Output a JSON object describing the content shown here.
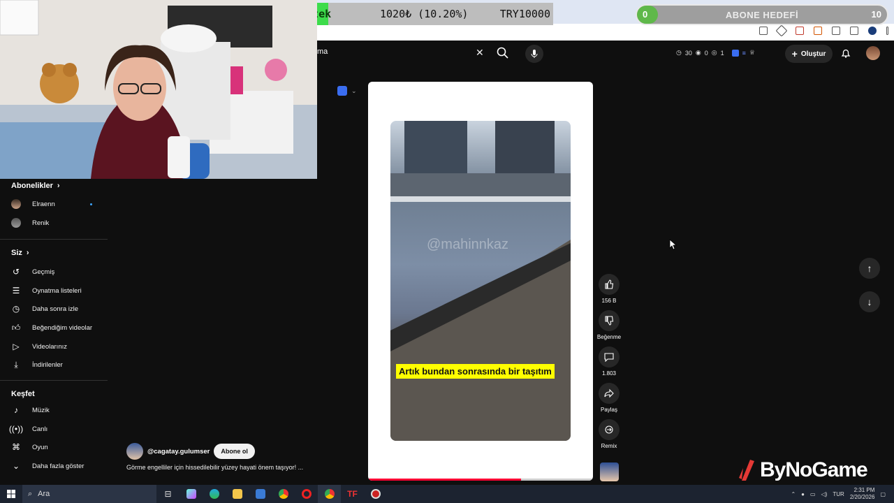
{
  "donation": {
    "title": "Destek",
    "amount": "1020₺ (10.20%)",
    "target": "TRY10000"
  },
  "goal": {
    "min": "0",
    "label": "ABONE HEDEFİ",
    "max": "10"
  },
  "header": {
    "search_value": "ma",
    "stats": {
      "a": "30",
      "b": "0",
      "c": "1"
    },
    "create_label": "Oluştur"
  },
  "sidebar": {
    "subscriptions_title": "Abonelikler",
    "channels": [
      {
        "label": "Elraenn"
      },
      {
        "label": "Renik"
      }
    ],
    "you_title": "Siz",
    "you_items": [
      {
        "label": "Geçmiş",
        "icon": "history-icon"
      },
      {
        "label": "Oynatma listeleri",
        "icon": "playlist-icon"
      },
      {
        "label": "Daha sonra izle",
        "icon": "clock-icon"
      },
      {
        "label": "Beğendiğim videolar",
        "icon": "thumbs-up-icon"
      },
      {
        "label": "Videolarınız",
        "icon": "play-square-icon"
      },
      {
        "label": "İndirilenler",
        "icon": "download-icon"
      }
    ],
    "explore_title": "Keşfet",
    "explore_items": [
      {
        "label": "Müzik",
        "icon": "music-note-icon"
      },
      {
        "label": "Canlı",
        "icon": "live-icon"
      },
      {
        "label": "Oyun",
        "icon": "gamepad-icon"
      },
      {
        "label": "Daha fazla göster",
        "icon": "chevron-down-icon"
      }
    ]
  },
  "player": {
    "watermark": "@mahinnkaz",
    "caption": "Artık bundan sonrasında bir taşıtım",
    "progress": 0.68
  },
  "actions": {
    "likes": "156 B",
    "dislike": "Beğenme",
    "comments": "1.803",
    "share": "Paylaş",
    "remix": "Remix"
  },
  "channel": {
    "name": "@cagatay.gulumser",
    "subscribe": "Abone ol",
    "title": "Görme engelliler için hissedilebilir yüzey hayati önem taşıyor! ..."
  },
  "logo": {
    "text": "ByNoGame"
  },
  "taskbar": {
    "search_placeholder": "Ara",
    "lang": "TUR",
    "time": "2:31 PM",
    "date": "2/20/2026"
  },
  "colors": {
    "accent_red": "#ff0033",
    "donate_green": "#3ddc4b",
    "caption_yellow": "#ffff00"
  }
}
